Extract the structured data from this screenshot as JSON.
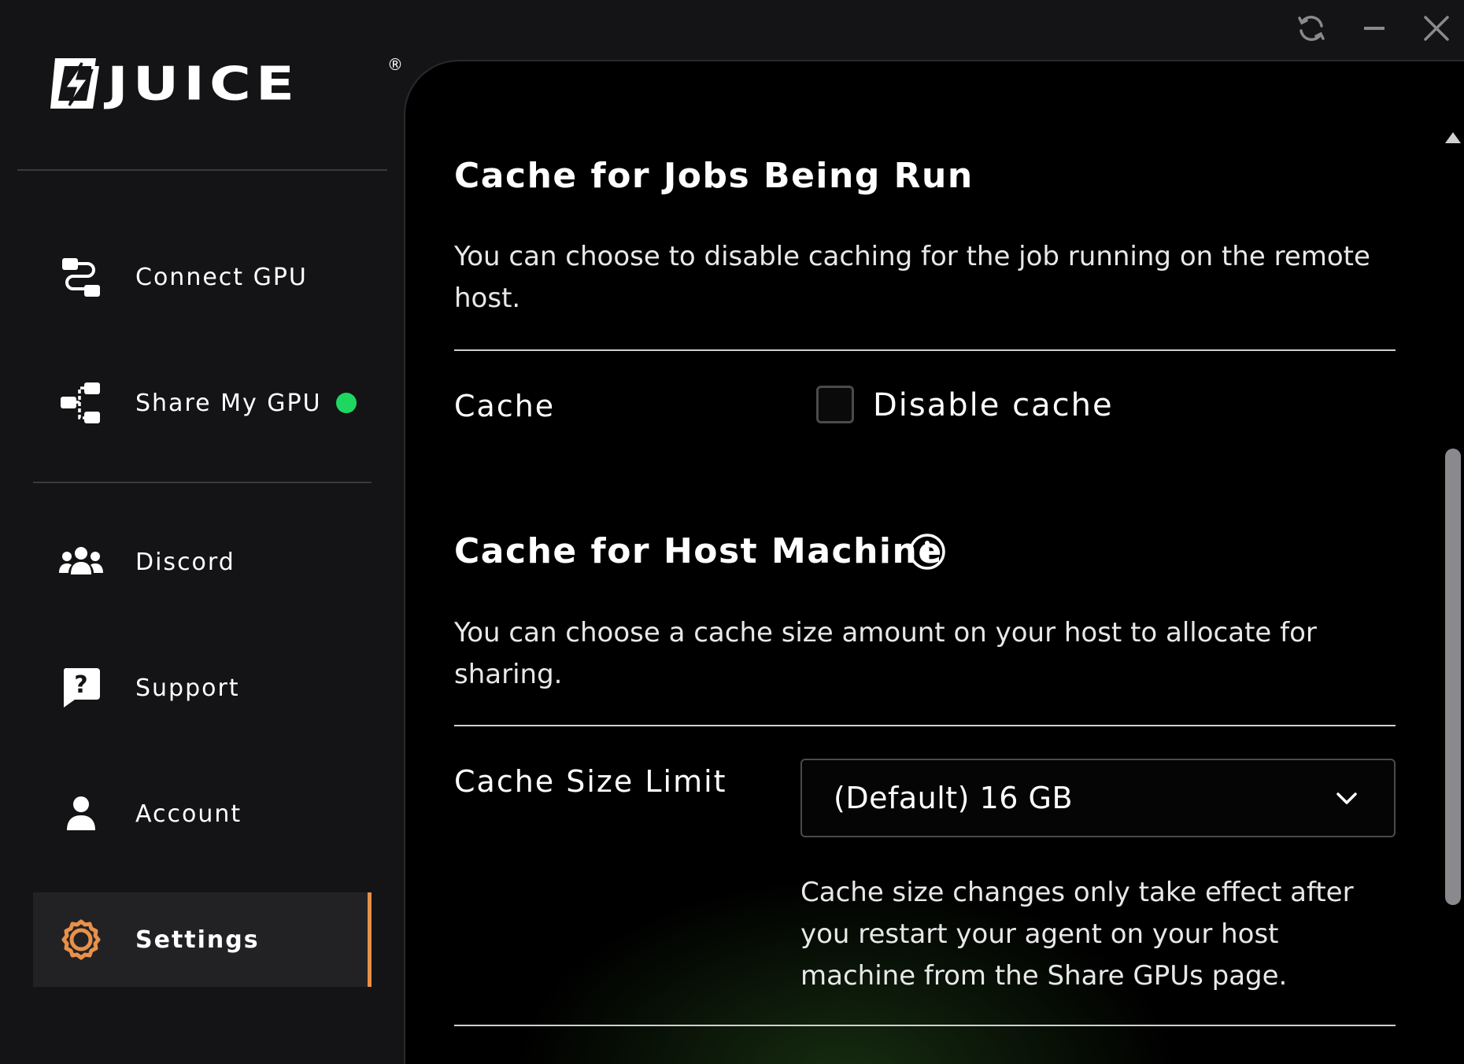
{
  "app": {
    "logo_text": "JUICE",
    "logo_reg": "®"
  },
  "window_controls": {
    "sync_icon": "sync-icon",
    "minimize_icon": "minimize-icon",
    "close_icon": "close-icon"
  },
  "sidebar": {
    "items": [
      {
        "label": "Connect GPU",
        "icon": "connect-gpu-icon"
      },
      {
        "label": "Share My GPU",
        "icon": "share-gpu-icon",
        "status": "online"
      },
      {
        "label": "Discord",
        "icon": "people-icon"
      },
      {
        "label": "Support",
        "icon": "question-bubble-icon"
      },
      {
        "label": "Account",
        "icon": "user-icon"
      },
      {
        "label": "Settings",
        "icon": "gear-icon",
        "active": true
      }
    ],
    "status_color": "#1ed760",
    "active_color": "#e8914a"
  },
  "main": {
    "jobs_cache": {
      "title": "Cache for Jobs Being Run",
      "description": "You can choose to disable caching for the job running on the remote host.",
      "field_label": "Cache",
      "checkbox_label": "Disable cache",
      "checkbox_checked": false
    },
    "host_cache": {
      "title": "Cache for Host Machine",
      "info_icon": "info-icon",
      "description": "You can choose a cache size amount on your host to allocate for sharing.",
      "field_label": "Cache Size Limit",
      "select_value": "(Default) 16 GB",
      "note": "Cache size changes only take effect after you restart your agent on your host machine from the Share GPUs page."
    }
  }
}
